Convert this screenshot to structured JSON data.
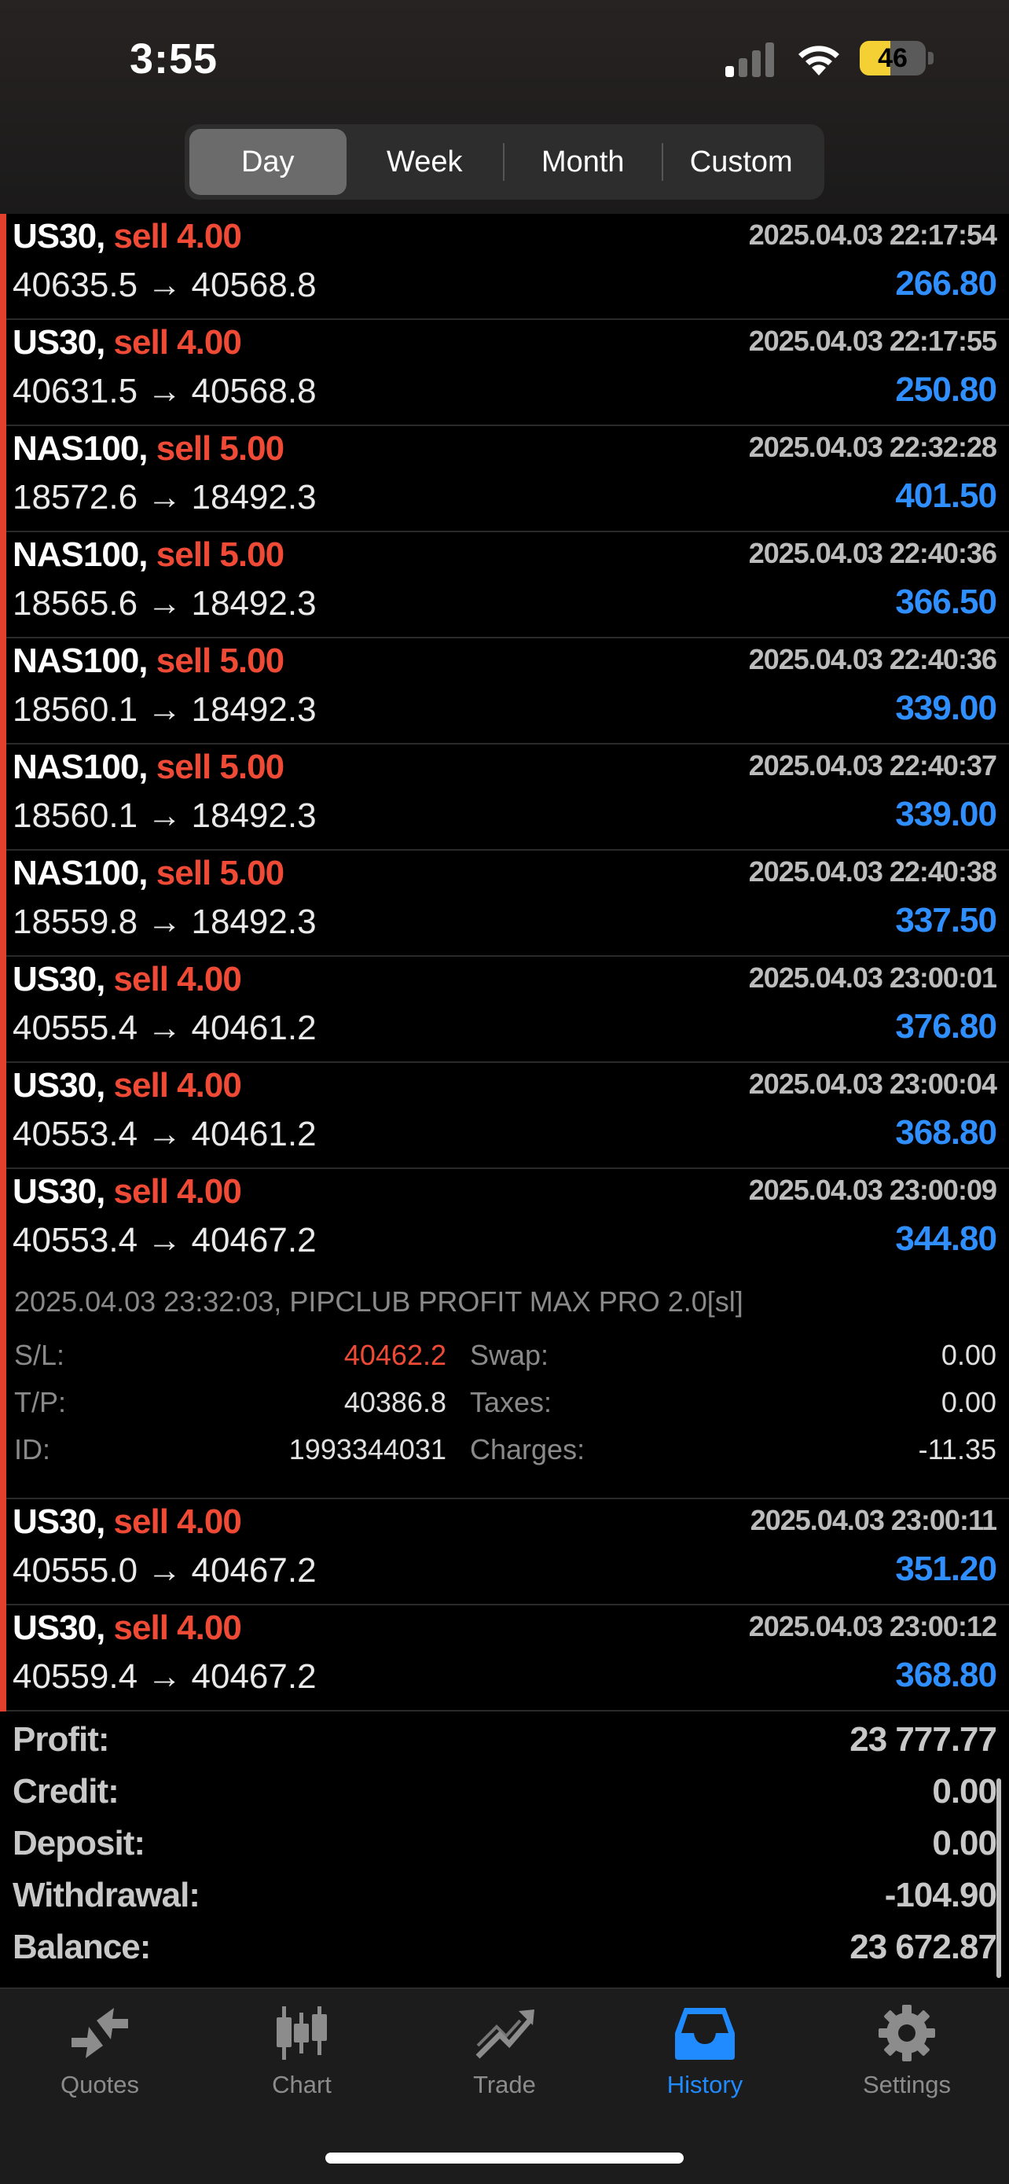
{
  "status_bar": {
    "time": "3:55",
    "battery": "46",
    "battery_level": 0.46
  },
  "period_tabs": [
    {
      "label": "Day",
      "active": true
    },
    {
      "label": "Week",
      "active": false
    },
    {
      "label": "Month",
      "active": false
    },
    {
      "label": "Custom",
      "active": false
    }
  ],
  "deals": [
    {
      "symbol": "US30,",
      "action": "sell 4.00",
      "prices": "40635.5 → 40568.8",
      "time": "2025.04.03 22:17:54",
      "profit": "266.80"
    },
    {
      "symbol": "US30,",
      "action": "sell 4.00",
      "prices": "40631.5 → 40568.8",
      "time": "2025.04.03 22:17:55",
      "profit": "250.80"
    },
    {
      "symbol": "NAS100,",
      "action": "sell 5.00",
      "prices": "18572.6 → 18492.3",
      "time": "2025.04.03 22:32:28",
      "profit": "401.50"
    },
    {
      "symbol": "NAS100,",
      "action": "sell 5.00",
      "prices": "18565.6 → 18492.3",
      "time": "2025.04.03 22:40:36",
      "profit": "366.50"
    },
    {
      "symbol": "NAS100,",
      "action": "sell 5.00",
      "prices": "18560.1 → 18492.3",
      "time": "2025.04.03 22:40:36",
      "profit": "339.00"
    },
    {
      "symbol": "NAS100,",
      "action": "sell 5.00",
      "prices": "18560.1 → 18492.3",
      "time": "2025.04.03 22:40:37",
      "profit": "339.00"
    },
    {
      "symbol": "NAS100,",
      "action": "sell 5.00",
      "prices": "18559.8 → 18492.3",
      "time": "2025.04.03 22:40:38",
      "profit": "337.50"
    },
    {
      "symbol": "US30,",
      "action": "sell 4.00",
      "prices": "40555.4 → 40461.2",
      "time": "2025.04.03 23:00:01",
      "profit": "376.80"
    },
    {
      "symbol": "US30,",
      "action": "sell 4.00",
      "prices": "40553.4 → 40461.2",
      "time": "2025.04.03 23:00:04",
      "profit": "368.80"
    },
    {
      "symbol": "US30,",
      "action": "sell 4.00",
      "prices": "40553.4 → 40467.2",
      "time": "2025.04.03 23:00:09",
      "profit": "344.80",
      "details": {
        "comment": "2025.04.03 23:32:03, PIPCLUB PROFIT MAX PRO 2.0[sl]",
        "sl_label": "S/L:",
        "sl": "40462.2",
        "tp_label": "T/P:",
        "tp": "40386.8",
        "id_label": "ID:",
        "id": "1993344031",
        "swap_label": "Swap:",
        "swap": "0.00",
        "taxes_label": "Taxes:",
        "taxes": "0.00",
        "charges_label": "Charges:",
        "charges": "-11.35"
      }
    },
    {
      "symbol": "US30,",
      "action": "sell 4.00",
      "prices": "40555.0 → 40467.2",
      "time": "2025.04.03 23:00:11",
      "profit": "351.20"
    },
    {
      "symbol": "US30,",
      "action": "sell 4.00",
      "prices": "40559.4 → 40467.2",
      "time": "2025.04.03 23:00:12",
      "profit": "368.80"
    }
  ],
  "summary": [
    {
      "label": "Profit:",
      "value": "23 777.77"
    },
    {
      "label": "Credit:",
      "value": "0.00"
    },
    {
      "label": "Deposit:",
      "value": "0.00"
    },
    {
      "label": "Withdrawal:",
      "value": "-104.90"
    },
    {
      "label": "Balance:",
      "value": "23 672.87"
    }
  ],
  "tab_bar": [
    {
      "label": "Quotes",
      "icon": "quotes-icon",
      "active": false
    },
    {
      "label": "Chart",
      "icon": "chart-icon",
      "active": false
    },
    {
      "label": "Trade",
      "icon": "trade-icon",
      "active": false
    },
    {
      "label": "History",
      "icon": "history-icon",
      "active": true
    },
    {
      "label": "Settings",
      "icon": "gear-icon",
      "active": false
    }
  ],
  "colors": {
    "sell": "#ef4a36",
    "profit": "#2f8fff",
    "active_tab": "#1f8bff"
  }
}
